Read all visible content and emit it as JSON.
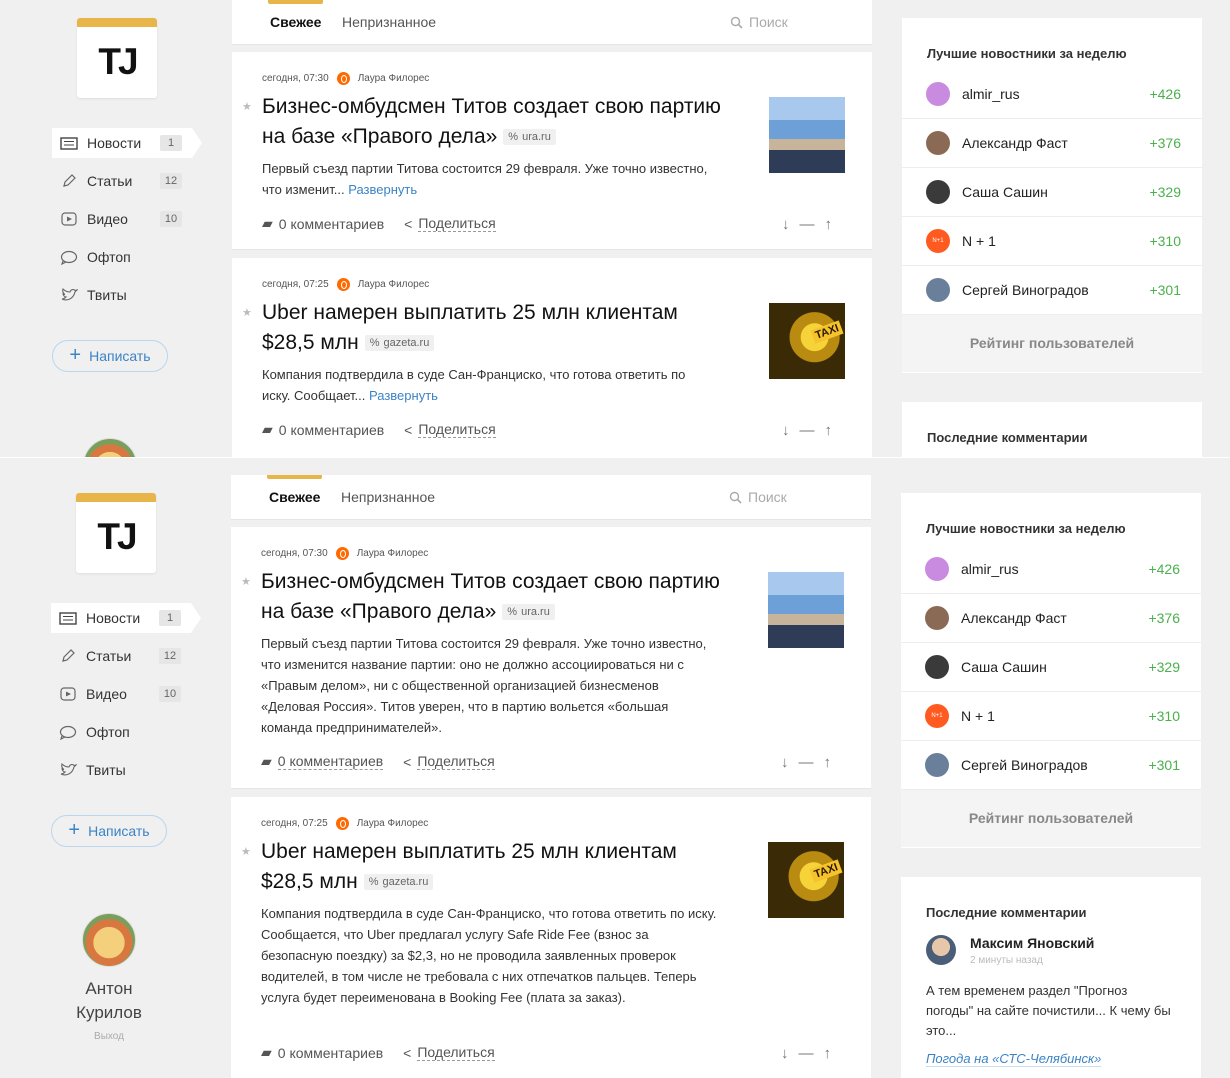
{
  "brand": {
    "logo_text": "TJ",
    "accent": "#e8b54a"
  },
  "sidebar": {
    "items": [
      {
        "label": "Новости",
        "badge": "1",
        "icon": "news-icon"
      },
      {
        "label": "Статьи",
        "badge": "12",
        "icon": "pencil-icon"
      },
      {
        "label": "Видео",
        "badge": "10",
        "icon": "video-icon"
      },
      {
        "label": "Офтоп",
        "badge": "",
        "icon": "chat-icon"
      },
      {
        "label": "Твиты",
        "badge": "",
        "icon": "twitter-icon"
      }
    ],
    "write_label": "Написать",
    "user": {
      "name_line1": "Антон",
      "name_line2": "Курилов",
      "exit_label": "Выход"
    }
  },
  "tabs": {
    "fresh": "Свежее",
    "unrecognized": "Непризнанное",
    "search_placeholder": "Поиск"
  },
  "posts": [
    {
      "time": "сегодня, 07:30",
      "author": "Лаура Филорес",
      "title": "Бизнес-омбудсмен Титов создает свою партию на базе «Правого дела»",
      "source": "ura.ru",
      "excerpt_short": "Первый съезд партии Титова состоится 29 февраля. Уже точно известно, что изменит...",
      "excerpt_full": "Первый съезд партии Титова состоится 29 февраля. Уже точно известно, что изменится название партии: оно не должно ассоциироваться ни с «Правым делом», ни с общественной организацией бизнесменов «Деловая Россия». Титов уверен, что в партию вольется «большая команда предпринимателей».",
      "expand_label": "Развернуть",
      "comments": "0 комментариев",
      "share": "Поделиться"
    },
    {
      "time": "сегодня, 07:25",
      "author": "Лаура Филорес",
      "title": "Uber намерен выплатить 25 млн клиентам $28,5 млн",
      "source": "gazeta.ru",
      "excerpt_short": "Компания подтвердила в суде Сан-Франциско, что готова ответить по иску. Сообщает...",
      "excerpt_full": "Компания подтвердила в суде Сан-Франциско, что готова ответить по иску. Сообщается, что Uber предлагал услугу Safe Ride Fee (взнос за безопасную поездку) за $2,3, но не проводила заявленных проверок водителей, в том числе не требовала с них отпечатков пальцев. Теперь услуга будет переименована в Booking Fee (плата за заказ).",
      "expand_label": "Развернуть",
      "comments": "0 комментариев",
      "share": "Поделиться",
      "thumb_label": "TAXI"
    }
  ],
  "leaders": {
    "title": "Лучшие новостники за неделю",
    "items": [
      {
        "name": "almir_rus",
        "score": "+426",
        "color": "#c98be0"
      },
      {
        "name": "Александр Фаст",
        "score": "+376",
        "color": "#8a6a55"
      },
      {
        "name": "Саша Сашин",
        "score": "+329",
        "color": "#3a3a3a"
      },
      {
        "name": "N + 1",
        "score": "+310",
        "color": "#ff5a1f",
        "avatar_text": "N+1"
      },
      {
        "name": "Сергей Виноградов",
        "score": "+301",
        "color": "#6a7f99"
      }
    ],
    "rating_link": "Рейтинг пользователей"
  },
  "comments_block": {
    "title": "Последние комментарии",
    "author": "Максим Яновский",
    "time": "2 минуты назад",
    "text": "А тем временем раздел \"Прогноз погоды\" на сайте почистили... К чему бы это...",
    "post_link": "Погода на «СТС-Челябинск»"
  }
}
